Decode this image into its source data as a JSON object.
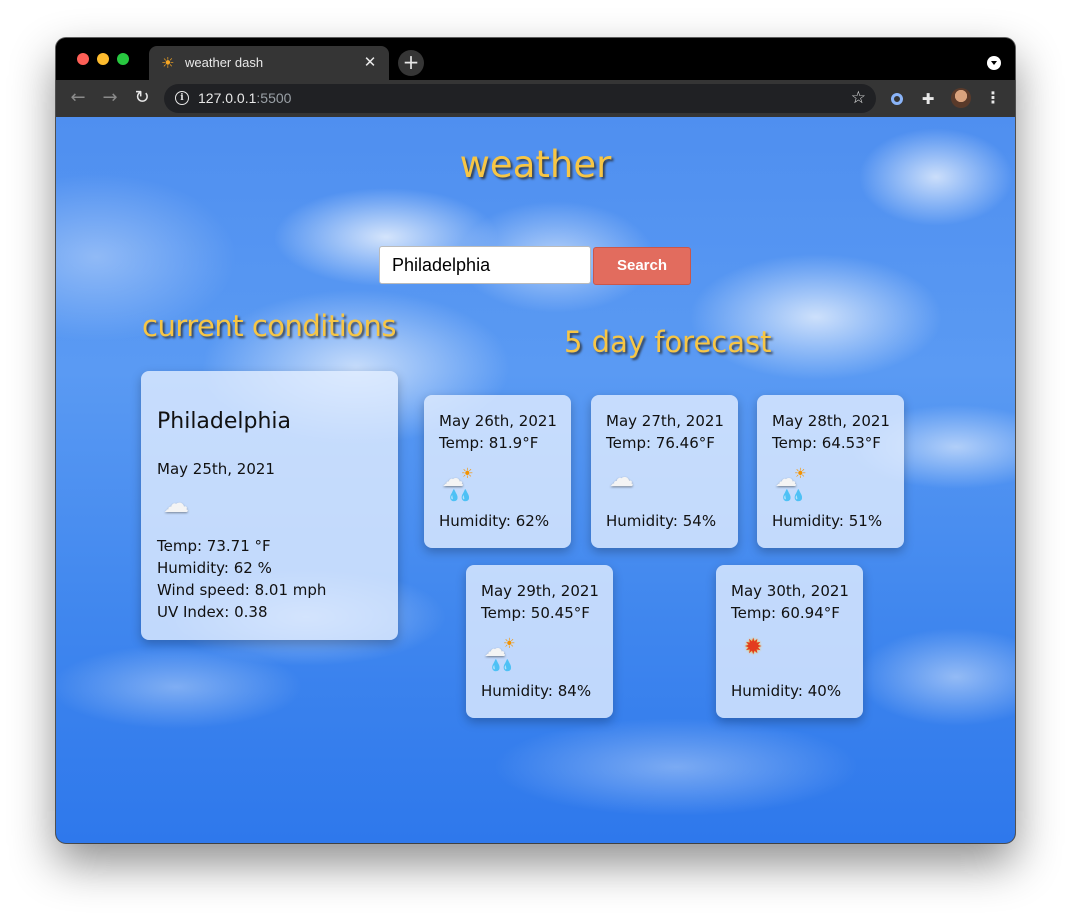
{
  "browser": {
    "tab_title": "weather dash",
    "tab_icon": "sun-icon",
    "url_host": "127.0.0.1",
    "url_port": ":5500",
    "new_tab_glyph": "+",
    "close_glyph": "✕"
  },
  "app": {
    "title": "weather",
    "search": {
      "value": "Philadelphia",
      "button_label": "Search"
    },
    "current_heading": "current conditions",
    "forecast_heading": "5 day forecast"
  },
  "current": {
    "city": "Philadelphia",
    "date": "May 25th, 2021",
    "icon": "cloud-icon",
    "temp": "Temp: 73.71 °F",
    "humidity": "Humidity: 62 %",
    "wind": "Wind speed: 8.01 mph",
    "uv": "UV Index: 0.38"
  },
  "forecast": [
    {
      "date": "May 26th, 2021",
      "temp": "Temp: 81.9°F",
      "icon": "rain-sun-icon",
      "humidity": "Humidity: 62%"
    },
    {
      "date": "May 27th, 2021",
      "temp": "Temp: 76.46°F",
      "icon": "cloud-icon",
      "humidity": "Humidity: 54%"
    },
    {
      "date": "May 28th, 2021",
      "temp": "Temp: 64.53°F",
      "icon": "rain-sun-icon",
      "humidity": "Humidity: 51%"
    },
    {
      "date": "May 29th, 2021",
      "temp": "Temp: 50.45°F",
      "icon": "rain-sun-icon",
      "humidity": "Humidity: 84%"
    },
    {
      "date": "May 30th, 2021",
      "temp": "Temp: 60.94°F",
      "icon": "sun-icon",
      "humidity": "Humidity: 40%"
    }
  ],
  "colors": {
    "title": "#f7c645",
    "search_button": "#e26c5e",
    "sky": "#4f8ff0"
  }
}
